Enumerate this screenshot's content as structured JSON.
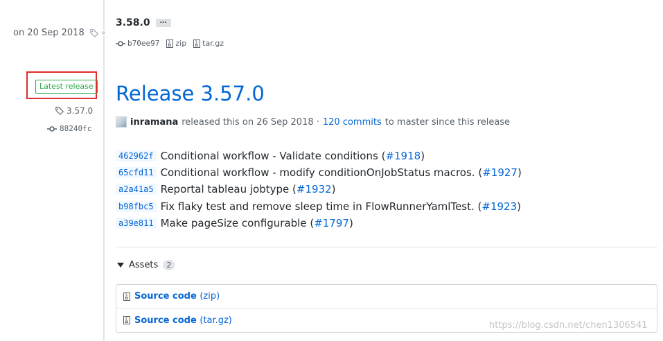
{
  "previous_release": {
    "date": "on 20 Sep 2018",
    "version": "3.58.0",
    "ellipsis": "…",
    "commit": "b70ee97",
    "zip": "zip",
    "targz": "tar.gz"
  },
  "sidebar": {
    "latest_label": "Latest release",
    "tag": "3.57.0",
    "commit": "88240fc"
  },
  "release": {
    "title": "Release 3.57.0",
    "author": "inramana",
    "released_text": "released this on 26 Sep 2018 ·",
    "commits_link": "120 commits",
    "since_text": "to master since this release"
  },
  "commits": [
    {
      "sha": "462962f",
      "message": "Conditional workflow - Validate conditions (",
      "pr": "#1918",
      "tail": ")"
    },
    {
      "sha": "65cfd11",
      "message": "Conditional workflow - modify conditionOnJobStatus macros. (",
      "pr": "#1927",
      "tail": ")"
    },
    {
      "sha": "a2a41a5",
      "message": "Reportal tableau jobtype (",
      "pr": "#1932",
      "tail": ")"
    },
    {
      "sha": "b98fbc5",
      "message": "Fix flaky test and remove sleep time in FlowRunnerYamlTest. (",
      "pr": "#1923",
      "tail": ")"
    },
    {
      "sha": "a39e811",
      "message": "Make pageSize configurable (",
      "pr": "#1797",
      "tail": ")"
    }
  ],
  "assets": {
    "label": "Assets",
    "count": "2",
    "items": [
      {
        "name": "Source code",
        "ext": "(zip)"
      },
      {
        "name": "Source code",
        "ext": "(tar.gz)"
      }
    ]
  },
  "watermark": "https://blog.csdn.net/chen1306541",
  "colors": {
    "link": "#0366d6",
    "latest_green": "#28a745",
    "highlight_red": "#e02c2c"
  }
}
